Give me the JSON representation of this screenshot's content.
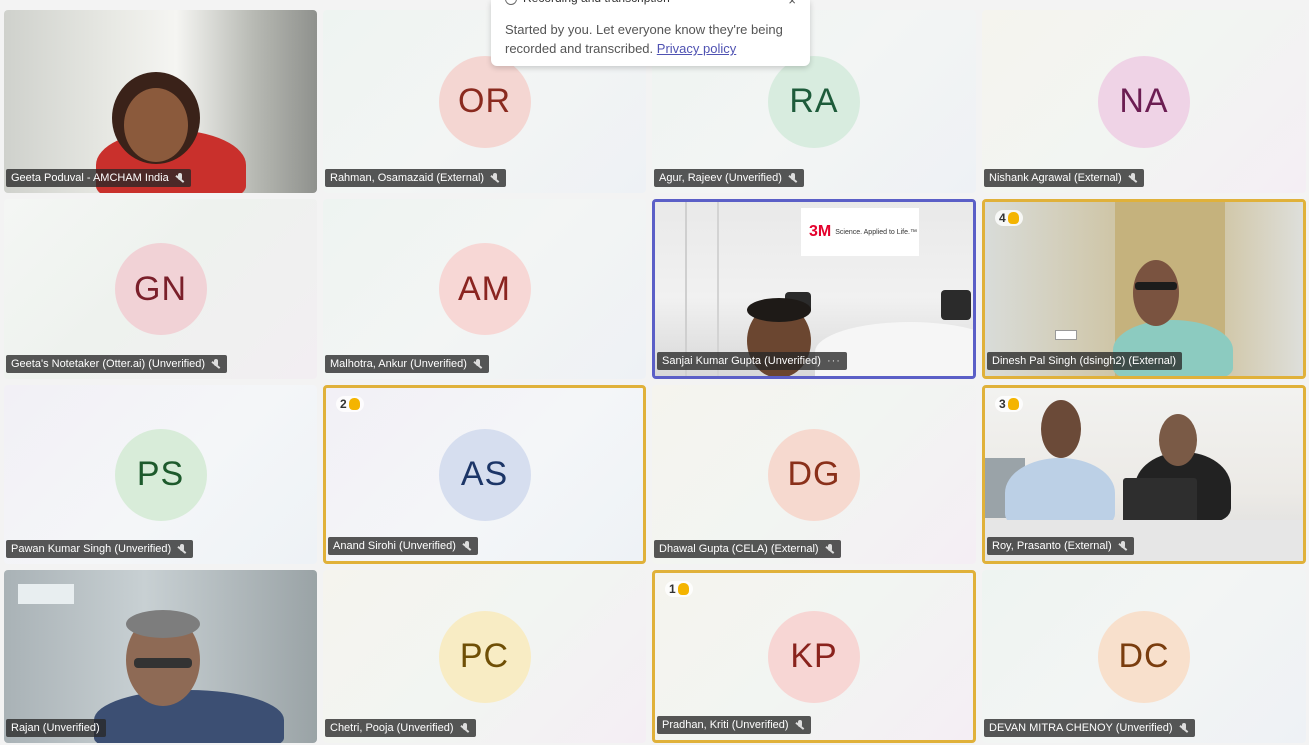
{
  "notification": {
    "title": "Recording and transcription",
    "body": "Started by you. Let everyone know they're being recorded and transcribed.",
    "link": "Privacy policy",
    "close_glyph": "×"
  },
  "tiles": [
    {
      "name": "Geeta Poduval - AMCHAM India",
      "type": "video"
    },
    {
      "name": "Rahman, Osamazaid (External)",
      "initials": "OR",
      "bg": "#f4d6d2",
      "fg": "#8a2a1f"
    },
    {
      "name": "Agur, Rajeev (Unverified)",
      "initials": "RA",
      "bg": "#d8ecdf",
      "fg": "#1d5b3a"
    },
    {
      "name": "Nishank Agrawal (External)",
      "initials": "NA",
      "bg": "#efd3e6",
      "fg": "#6b1d52"
    },
    {
      "name": "Geeta's Notetaker (Otter.ai) (Unverified)",
      "initials": "GN",
      "bg": "#f1d2d6",
      "fg": "#7a1f2a"
    },
    {
      "name": "Malhotra, Ankur (Unverified)",
      "initials": "AM",
      "bg": "#f7d7d5",
      "fg": "#8a2420"
    },
    {
      "name": "Sanjai Kumar Gupta (Unverified)",
      "type": "video",
      "logo": "3M",
      "logo_tag": "Science. Applied to Life.™",
      "more": "···"
    },
    {
      "name": "Dinesh Pal Singh (dsingh2) (External)",
      "type": "video",
      "hand": "4"
    },
    {
      "name": "Pawan Kumar Singh (Unverified)",
      "initials": "PS",
      "bg": "#d8ecd9",
      "fg": "#1d5a2c"
    },
    {
      "name": "Anand Sirohi (Unverified)",
      "initials": "AS",
      "bg": "#d6deef",
      "fg": "#1c3567",
      "hand": "2"
    },
    {
      "name": "Dhawal Gupta (CELA) (External)",
      "initials": "DG",
      "bg": "#f6d9cf",
      "fg": "#8a301a"
    },
    {
      "name": "Roy, Prasanto (External)",
      "type": "video",
      "hand": "3"
    },
    {
      "name": "Rajan (Unverified)",
      "type": "video"
    },
    {
      "name": "Chetri, Pooja (Unverified)",
      "initials": "PC",
      "bg": "#f8ecc4",
      "fg": "#6f4f06"
    },
    {
      "name": "Pradhan, Kriti (Unverified)",
      "initials": "KP",
      "bg": "#f7d6d4",
      "fg": "#8a231d",
      "hand": "1"
    },
    {
      "name": "DEVAN MITRA CHENOY (Unverified)",
      "initials": "DC",
      "bg": "#f8e0cc",
      "fg": "#7a3d0e"
    }
  ]
}
